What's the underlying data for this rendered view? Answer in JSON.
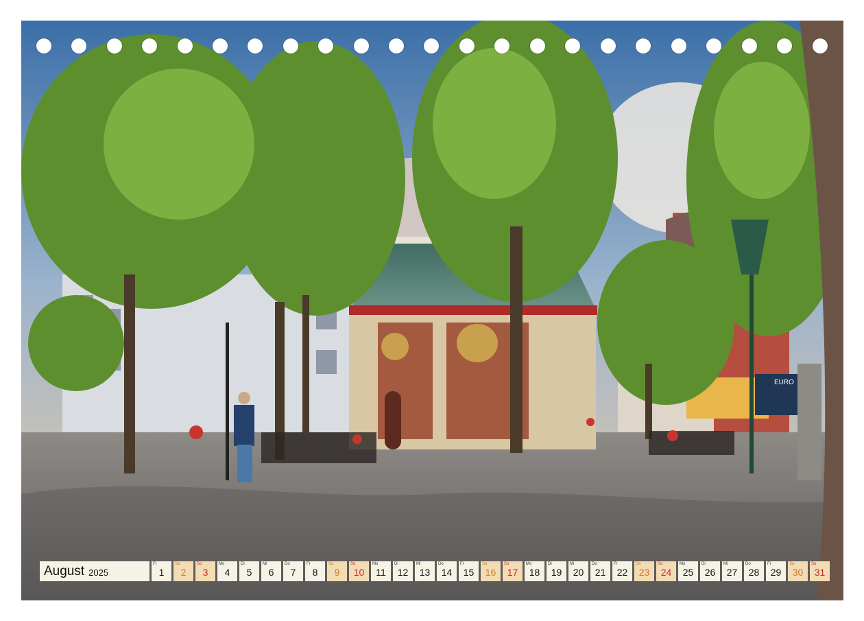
{
  "calendar": {
    "month": "August",
    "year": "2025",
    "days": [
      {
        "wd": "Fr",
        "n": "1",
        "t": "wk"
      },
      {
        "wd": "Sa",
        "n": "2",
        "t": "sa"
      },
      {
        "wd": "So",
        "n": "3",
        "t": "su"
      },
      {
        "wd": "Mo",
        "n": "4",
        "t": "wk"
      },
      {
        "wd": "Di",
        "n": "5",
        "t": "wk"
      },
      {
        "wd": "Mi",
        "n": "6",
        "t": "wk"
      },
      {
        "wd": "Do",
        "n": "7",
        "t": "wk"
      },
      {
        "wd": "Fr",
        "n": "8",
        "t": "wk"
      },
      {
        "wd": "Sa",
        "n": "9",
        "t": "sa"
      },
      {
        "wd": "So",
        "n": "10",
        "t": "su"
      },
      {
        "wd": "Mo",
        "n": "11",
        "t": "wk"
      },
      {
        "wd": "Di",
        "n": "12",
        "t": "wk"
      },
      {
        "wd": "Mi",
        "n": "13",
        "t": "wk"
      },
      {
        "wd": "Do",
        "n": "14",
        "t": "wk"
      },
      {
        "wd": "Fr",
        "n": "15",
        "t": "wk"
      },
      {
        "wd": "Sa",
        "n": "16",
        "t": "sa"
      },
      {
        "wd": "So",
        "n": "17",
        "t": "su"
      },
      {
        "wd": "Mo",
        "n": "18",
        "t": "wk"
      },
      {
        "wd": "Di",
        "n": "19",
        "t": "wk"
      },
      {
        "wd": "Mi",
        "n": "20",
        "t": "wk"
      },
      {
        "wd": "Do",
        "n": "21",
        "t": "wk"
      },
      {
        "wd": "Fr",
        "n": "22",
        "t": "wk"
      },
      {
        "wd": "Sa",
        "n": "23",
        "t": "sa"
      },
      {
        "wd": "So",
        "n": "24",
        "t": "su"
      },
      {
        "wd": "Mo",
        "n": "25",
        "t": "wk"
      },
      {
        "wd": "Di",
        "n": "26",
        "t": "wk"
      },
      {
        "wd": "Mi",
        "n": "27",
        "t": "wk"
      },
      {
        "wd": "Do",
        "n": "28",
        "t": "wk"
      },
      {
        "wd": "Fr",
        "n": "29",
        "t": "wk"
      },
      {
        "wd": "Sa",
        "n": "30",
        "t": "sa"
      },
      {
        "wd": "So",
        "n": "31",
        "t": "su"
      }
    ]
  },
  "photo": {
    "shop_sign": "EURO"
  },
  "colors": {
    "saturday": "#c87a2a",
    "sunday": "#c42a2a",
    "weekend_bg": "#f3dcb4",
    "weekday_bg": "#f5f2e6"
  }
}
